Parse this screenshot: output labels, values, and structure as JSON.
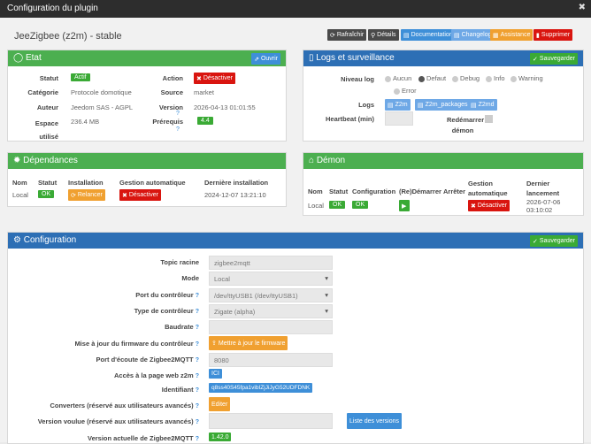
{
  "window": {
    "title": "Configuration du plugin",
    "close": "✖"
  },
  "plugin_title": "JeeZigbee (z2m) - stable",
  "toolbar": {
    "refresh": "Rafraîchir",
    "details": "Détails",
    "docs": "Documentation",
    "changelog": "Changelog",
    "assistance": "Assistance",
    "delete": "Supprimer"
  },
  "etat": {
    "title": "Etat",
    "open": "Ouvrir",
    "rows": [
      {
        "label": "Statut",
        "value": "Actif"
      },
      {
        "label": "Catégorie",
        "value": "Protocole domotique"
      },
      {
        "label": "Auteur",
        "value": "Jeedom SAS - AGPL"
      },
      {
        "label": "Espace utilisé",
        "value": "236.4 MB"
      }
    ],
    "right": [
      {
        "label": "Action",
        "value": "Désactiver"
      },
      {
        "label": "Source",
        "value": "market"
      },
      {
        "label": "Version",
        "value": "2026-04-13 01:01:55"
      },
      {
        "label": "Prérequis",
        "value": "4.4"
      }
    ]
  },
  "logs": {
    "title": "Logs et surveillance",
    "save": "Sauvegarder",
    "niveau_label": "Niveau log",
    "levels": [
      "Aucun",
      "Defaut",
      "Debug",
      "Info",
      "Warning",
      "Error"
    ],
    "logs_label": "Logs",
    "log_buttons": [
      "Z2m",
      "Z2m_packages",
      "Z2md"
    ],
    "heartbeat_label": "Heartbeat (min)",
    "restart_label": "Redémarrer démon"
  },
  "dependances": {
    "title": "Dépendances",
    "headers": [
      "Nom",
      "Statut",
      "Installation",
      "Gestion automatique",
      "Dernière installation"
    ],
    "row": {
      "name": "Local",
      "status": "OK",
      "install": "Relancer",
      "auto": "Désactiver",
      "last": "2024-12-07 13:21:10"
    }
  },
  "demon": {
    "title": "Démon",
    "headers": [
      "Nom",
      "Statut",
      "Configuration",
      "(Re)Démarrer",
      "Arrêter",
      "Gestion automatique",
      "Dernier lancement"
    ],
    "row": {
      "name": "Local",
      "status": "OK",
      "config": "OK",
      "auto": "Désactiver",
      "last": "2026-07-06 03:10:02"
    }
  },
  "config": {
    "title": "Configuration",
    "save": "Sauvegarder",
    "topic_label": "Topic racine",
    "topic_value": "zigbee2mqtt",
    "mode_label": "Mode",
    "mode_value": "Local",
    "port_label": "Port du contrôleur",
    "port_value": "/dev/ttyUSB1 (/dev/ttyUSB1)",
    "type_label": "Type de contrôleur",
    "type_value": "Zigate (alpha)",
    "baud_label": "Baudrate",
    "baud_value": "",
    "firmware_label": "Mise à jour du firmware du contrôleur",
    "firmware_button": "Mettre à jour le firmware",
    "listen_label": "Port d'écoute de Zigbee2MQTT",
    "listen_value": "8080",
    "web_label": "Accès à la page web z2m",
    "web_value": "ICI",
    "id_label": "Identifiant",
    "id_value": "q8ss40S45fpa1vibIZjJiJyG52UDFDNK",
    "conv_label": "Converters (réservé aux utilisateurs avancés)",
    "conv_button": "Editer",
    "wanted_label": "Version voulue (réservé aux utilisateurs avancés)",
    "wanted_button": "Liste des versions",
    "current_label": "Version actuelle de Zigbee2MQTT",
    "current_value": "1.42.0"
  }
}
